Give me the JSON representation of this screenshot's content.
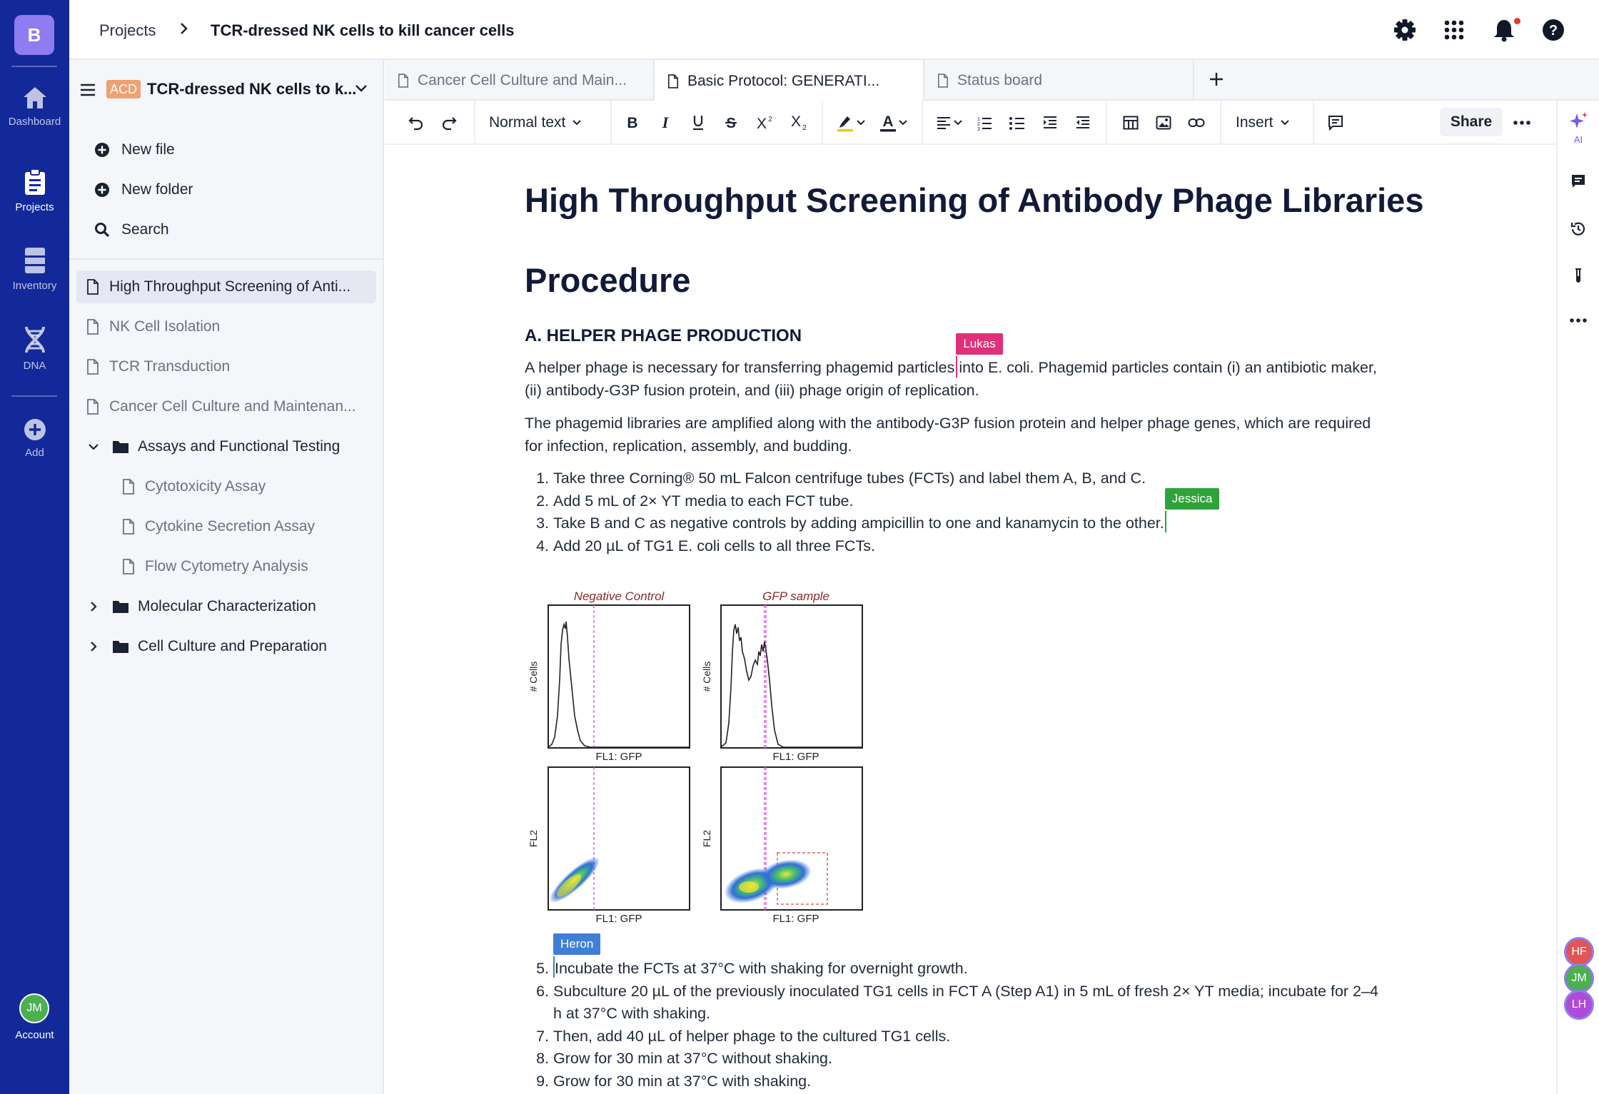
{
  "rail": {
    "brand_letter": "B",
    "items": [
      {
        "label": "Dashboard",
        "icon": "home-icon"
      },
      {
        "label": "Projects",
        "icon": "clipboard-icon"
      },
      {
        "label": "Inventory",
        "icon": "storage-icon"
      },
      {
        "label": "DNA",
        "icon": "dna-icon"
      },
      {
        "label": "Add",
        "icon": "plus-circle-icon"
      }
    ],
    "account": {
      "initials": "JM",
      "label": "Account"
    }
  },
  "topbar": {
    "breadcrumb_root": "Projects",
    "breadcrumb_current": "TCR-dressed NK cells to kill cancer cells",
    "icons": [
      "gear-icon",
      "apps-grid-icon",
      "bell-icon",
      "help-icon"
    ],
    "notification_dot": true
  },
  "sidebar": {
    "project_badge": "ACD",
    "project_name": "TCR-dressed NK cells to k...",
    "actions": {
      "new_file": "New file",
      "new_folder": "New folder",
      "search": "Search"
    },
    "tree": [
      {
        "label": "High Throughput Screening of Anti...",
        "type": "file",
        "selected": true
      },
      {
        "label": "NK Cell Isolation",
        "type": "file"
      },
      {
        "label": "TCR Transduction",
        "type": "file"
      },
      {
        "label": "Cancer Cell Culture and Maintenan...",
        "type": "file"
      },
      {
        "label": "Assays and Functional Testing",
        "type": "folder",
        "expanded": true
      },
      {
        "label": "Cytotoxicity Assay",
        "type": "file",
        "child": true
      },
      {
        "label": "Cytokine Secretion Assay",
        "type": "file",
        "child": true
      },
      {
        "label": "Flow Cytometry Analysis",
        "type": "file",
        "child": true
      },
      {
        "label": "Molecular Characterization",
        "type": "folder",
        "expanded": false
      },
      {
        "label": "Cell Culture and Preparation",
        "type": "folder",
        "expanded": false
      }
    ]
  },
  "tabs": [
    {
      "label": "Cancer Cell Culture and Main..."
    },
    {
      "label": "Basic Protocol: GENERATI...",
      "active": true
    },
    {
      "label": "Status board"
    }
  ],
  "toolbar": {
    "text_style": "Normal text",
    "insert": "Insert",
    "share": "Share",
    "highlight_color": "#f5c518",
    "text_color": "#1a2233"
  },
  "right_rail": {
    "ai_label": "AI",
    "collaborators": [
      {
        "initials": "HF",
        "color": "#e05656"
      },
      {
        "initials": "JM",
        "color": "#4caf50"
      },
      {
        "initials": "LH",
        "color": "#b04ad8"
      }
    ]
  },
  "doc": {
    "title": "High Throughput Screening of Antibody Phage Libraries",
    "procedure": "Procedure",
    "section_a": "A. HELPER PHAGE PRODUCTION",
    "para1_before": "A helper phage is necessary for transferring phagemid particles",
    "para1_after": "into E. coli. Phagemid particles contain (i) an antibiotic maker,",
    "para1_line2": "(ii) antibody-G3P fusion protein, and (iii) phage origin of replication.",
    "para2_line1": "The phagemid libraries are amplified along with the antibody-G3P fusion protein and helper phage genes, which are required",
    "para2_line2": "for infection, replication, assembly, and budding.",
    "steps_a": [
      {
        "n": "1.",
        "text": "Take three Corning® 50 mL Falcon centrifuge tubes (FCTs) and label them A, B, and C."
      },
      {
        "n": "2.",
        "text": "Add 5 mL of 2× YT media to each FCT tube."
      },
      {
        "n": "3.",
        "text": "Take B and C as negative controls by adding ampicillin to one and kanamycin to the other."
      },
      {
        "n": "4.",
        "text": "Add 20 µL of TG1 E. coli cells to all three FCTs."
      }
    ],
    "steps_b": [
      {
        "n": "5.",
        "text": "Incubate the FCTs at 37°C with shaking for overnight growth."
      },
      {
        "n": "6.",
        "text": "Subculture 20 µL of the previously inoculated TG1 cells in FCT A (Step A1) in 5 mL of fresh 2× YT media; incubate for 2–4"
      },
      {
        "n": "",
        "text": "h at 37°C with shaking."
      },
      {
        "n": "7.",
        "text": "Then, add 40 µL of helper phage to the cultured TG1 cells."
      },
      {
        "n": "8.",
        "text": "Grow for 30 min at 37°C without shaking."
      },
      {
        "n": "9.",
        "text": "Grow for 30 min at 37°C with shaking."
      }
    ],
    "cursors": [
      {
        "name": "Lukas",
        "color": "#e0307a"
      },
      {
        "name": "Jessica",
        "color": "#2fa33a"
      },
      {
        "name": "Heron",
        "color": "#3f7fd8"
      }
    ],
    "figure": {
      "panel_titles": [
        "Negative Control",
        "GFP sample"
      ],
      "y_label_hist": "# Cells",
      "y_label_dot": "FL2",
      "x_label": "FL1: GFP"
    }
  }
}
